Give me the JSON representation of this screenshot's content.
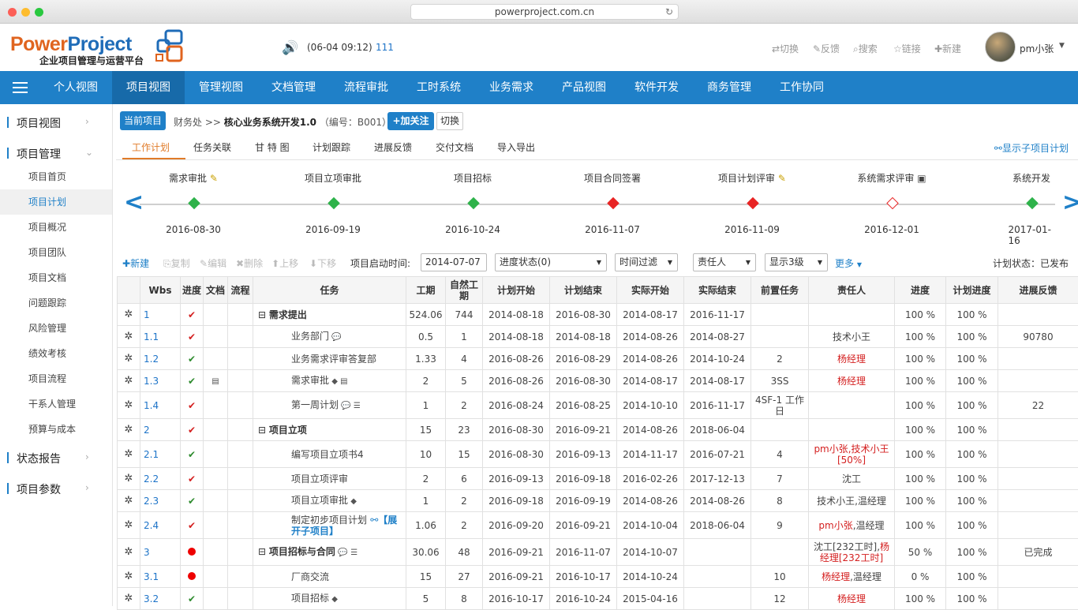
{
  "browser": {
    "url": "powerproject.com.cn",
    "reload_icon": "reload-icon"
  },
  "header": {
    "logo_power": "Power",
    "logo_project": "Project",
    "logo_sub": "企业项目管理与运营平台",
    "msg_time": "(06-04 09:12)",
    "msg_count": "111",
    "links": {
      "switch": "⇄切换",
      "feedback": "✎反馈",
      "search": "⌕搜索",
      "link": "☆链接",
      "new": "✚新建"
    },
    "user_name": "pm小张"
  },
  "nav": {
    "items": [
      "个人视图",
      "项目视图",
      "管理视图",
      "文档管理",
      "流程审批",
      "工时系统",
      "业务需求",
      "产品视图",
      "软件开发",
      "商务管理",
      "工作协同"
    ],
    "active": "项目视图"
  },
  "sidebar": {
    "project_view": "项目视图",
    "project_mgmt": "项目管理",
    "items": [
      "项目首页",
      "项目计划",
      "项目概况",
      "项目团队",
      "项目文档",
      "问题跟踪",
      "风险管理",
      "绩效考核",
      "项目流程",
      "干系人管理",
      "预算与成本"
    ],
    "status_report": "状态报告",
    "project_params": "项目参数"
  },
  "breadcrumb": {
    "current_project": "当前项目",
    "dept": "财务处 >>",
    "project_name": "核心业务系统开发1.0",
    "code": "（编号：B001）",
    "follow": "+加关注",
    "switch": "切换"
  },
  "subtabs": [
    "工作计划",
    "任务关联",
    "甘 特 图",
    "计划跟踪",
    "进展反馈",
    "交付文档",
    "导入导出"
  ],
  "show_sub_plan": "显示子项目计划",
  "milestones": [
    {
      "label": "需求审批",
      "date": "2016-08-30",
      "status": "green",
      "icon": "note-icon"
    },
    {
      "label": "项目立项审批",
      "date": "2016-09-19",
      "status": "green"
    },
    {
      "label": "项目招标",
      "date": "2016-10-24",
      "status": "green"
    },
    {
      "label": "项目合同签署",
      "date": "2016-11-07",
      "status": "red"
    },
    {
      "label": "项目计划评审",
      "date": "2016-11-09",
      "status": "red",
      "icon": "note-icon"
    },
    {
      "label": "系统需求评审",
      "date": "2016-12-01",
      "status": "hollow",
      "icon": "calendar-icon"
    },
    {
      "label": "系统开发",
      "date": "2017-01-16",
      "status": "green"
    }
  ],
  "toolbar": {
    "new": "新建",
    "copy": "复制",
    "edit": "编辑",
    "delete": "删除",
    "up": "上移",
    "down": "下移",
    "start_label": "项目启动时间:",
    "start_value": "2014-07-07",
    "progress_filter": "进度状态(0)",
    "time_filter": "时间过滤",
    "owner_filter": "责任人",
    "level_filter": "显示3级",
    "more": "更多",
    "plan_status": "计划状态：已发布"
  },
  "table": {
    "headers": [
      "",
      "Wbs",
      "进度",
      "文档",
      "流程",
      "任务",
      "工期",
      "自然工期",
      "计划开始",
      "计划结束",
      "实际开始",
      "实际结束",
      "前置任务",
      "责任人",
      "进度",
      "计划进度",
      "进展反馈"
    ],
    "rows": [
      {
        "wbs": "1",
        "mark": "check-red",
        "task": "需求提出",
        "level": 1,
        "dur": "524.06",
        "nat": "744",
        "ps": "2014-08-18",
        "pe": "2016-08-30",
        "as": "2014-08-17",
        "ae": "2016-11-17",
        "pre": "",
        "owner": "",
        "owner_red": false,
        "prog": "100 %",
        "pprog": "100 %",
        "fb": ""
      },
      {
        "wbs": "1.1",
        "mark": "check-red",
        "task": "业务部门",
        "level": 2,
        "icons": "comment",
        "dur": "0.5",
        "nat": "1",
        "ps": "2014-08-18",
        "pe": "2014-08-18",
        "as": "2014-08-26",
        "ae": "2014-08-27",
        "pre": "",
        "owner": "技术小王",
        "owner_red": false,
        "prog": "100 %",
        "pprog": "100 %",
        "fb": "90780"
      },
      {
        "wbs": "1.2",
        "mark": "check-green",
        "task": "业务需求评审答复部",
        "level": 2,
        "dur": "1.33",
        "nat": "4",
        "ps": "2016-08-26",
        "pe": "2016-08-29",
        "as": "2014-08-26",
        "ae": "2014-10-24",
        "pre": "2",
        "owner": "杨经理",
        "owner_red": true,
        "prog": "100 %",
        "pprog": "100 %",
        "fb": ""
      },
      {
        "wbs": "1.3",
        "mark": "check-green",
        "doc": true,
        "task": "需求审批",
        "level": 2,
        "icons": "diamond-doc",
        "dur": "2",
        "nat": "5",
        "ps": "2016-08-26",
        "pe": "2016-08-30",
        "as": "2014-08-17",
        "ae": "2014-08-17",
        "pre": "3SS",
        "owner": "杨经理",
        "owner_red": true,
        "prog": "100 %",
        "pprog": "100 %",
        "fb": ""
      },
      {
        "wbs": "1.4",
        "mark": "check-red",
        "task": "第一周计划",
        "level": 2,
        "icons": "comment-list",
        "dur": "1",
        "nat": "2",
        "ps": "2016-08-24",
        "pe": "2016-08-25",
        "as": "2014-10-10",
        "ae": "2016-11-17",
        "pre": "4SF-1 工作日",
        "owner": "",
        "owner_red": false,
        "prog": "100 %",
        "pprog": "100 %",
        "fb": "22"
      },
      {
        "wbs": "2",
        "mark": "check-red",
        "task": "项目立项",
        "level": 1,
        "dur": "15",
        "nat": "23",
        "ps": "2016-08-30",
        "pe": "2016-09-21",
        "as": "2014-08-26",
        "ae": "2018-06-04",
        "pre": "",
        "owner": "",
        "owner_red": false,
        "prog": "100 %",
        "pprog": "100 %",
        "fb": ""
      },
      {
        "wbs": "2.1",
        "mark": "check-green",
        "task": "编写项目立项书4",
        "level": 2,
        "dur": "10",
        "nat": "15",
        "ps": "2016-08-30",
        "pe": "2016-09-13",
        "as": "2014-11-17",
        "ae": "2016-07-21",
        "pre": "4",
        "owner": "pm小张,技术小王[50%]",
        "owner_red": true,
        "prog": "100 %",
        "pprog": "100 %",
        "fb": ""
      },
      {
        "wbs": "2.2",
        "mark": "check-red",
        "task": "项目立项评审",
        "level": 2,
        "dur": "2",
        "nat": "6",
        "ps": "2016-09-13",
        "pe": "2016-09-18",
        "as": "2016-02-26",
        "ae": "2017-12-13",
        "pre": "7",
        "owner": "沈工",
        "owner_red": false,
        "prog": "100 %",
        "pprog": "100 %",
        "fb": ""
      },
      {
        "wbs": "2.3",
        "mark": "check-green",
        "task": "项目立项审批",
        "level": 2,
        "icons": "diamond",
        "dur": "1",
        "nat": "2",
        "ps": "2016-09-18",
        "pe": "2016-09-19",
        "as": "2014-08-26",
        "ae": "2014-08-26",
        "pre": "8",
        "owner": "技术小王,温经理",
        "owner_red": false,
        "prog": "100 %",
        "pprog": "100 %",
        "fb": ""
      },
      {
        "wbs": "2.4",
        "mark": "check-red",
        "task": "制定初步项目计划",
        "level": 2,
        "expand": "【展开子项目】",
        "dur": "1.06",
        "nat": "2",
        "ps": "2016-09-20",
        "pe": "2016-09-21",
        "as": "2014-10-04",
        "ae": "2018-06-04",
        "pre": "9",
        "owner": "pm小张,温经理",
        "owner_red": "partial",
        "prog": "100 %",
        "pprog": "100 %",
        "fb": ""
      },
      {
        "wbs": "3",
        "mark": "dot-red",
        "task": "项目招标与合同",
        "level": 1,
        "icons": "comment-list",
        "dur": "30.06",
        "nat": "48",
        "ps": "2016-09-21",
        "pe": "2016-11-07",
        "as": "2014-10-07",
        "ae": "",
        "pre": "",
        "owner": "沈工[232工时],杨经理[232工时]",
        "owner_red": "partial2",
        "prog": "50 %",
        "pprog": "100 %",
        "fb": "已完成"
      },
      {
        "wbs": "3.1",
        "mark": "dot-red",
        "task": "厂商交流",
        "level": 2,
        "dur": "15",
        "nat": "27",
        "ps": "2016-09-21",
        "pe": "2016-10-17",
        "as": "2014-10-24",
        "ae": "",
        "pre": "10",
        "owner": "杨经理,温经理",
        "owner_red": "partial",
        "prog": "0 %",
        "pprog": "100 %",
        "fb": ""
      },
      {
        "wbs": "3.2",
        "mark": "check-green",
        "task": "项目招标",
        "level": 2,
        "icons": "diamond",
        "dur": "5",
        "nat": "8",
        "ps": "2016-10-17",
        "pe": "2016-10-24",
        "as": "2015-04-16",
        "ae": "",
        "pre": "12",
        "owner": "杨经理",
        "owner_red": true,
        "prog": "100 %",
        "pprog": "100 %",
        "fb": ""
      }
    ]
  }
}
